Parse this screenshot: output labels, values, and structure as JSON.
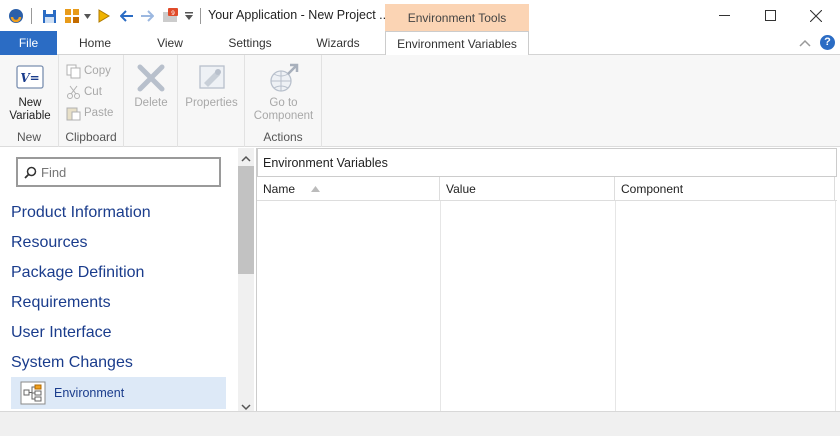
{
  "window": {
    "title": "Your Application - New Project ...",
    "context_tab_header": "Environment Tools"
  },
  "tabs": [
    {
      "label": "File"
    },
    {
      "label": "Home"
    },
    {
      "label": "View"
    },
    {
      "label": "Settings"
    },
    {
      "label": "Wizards"
    },
    {
      "label": "Environment Variables"
    }
  ],
  "ribbon": {
    "new_group": {
      "label": "New",
      "new_variable": "New\nVariable"
    },
    "clipboard_group": {
      "label": "Clipboard",
      "copy": "Copy",
      "cut": "Cut",
      "paste": "Paste"
    },
    "delete": "Delete",
    "properties": "Properties",
    "actions_group": {
      "label": "Actions",
      "go_to_component": "Go to\nComponent"
    }
  },
  "nav": {
    "find_placeholder": "Find",
    "items": [
      "Product Information",
      "Resources",
      "Package Definition",
      "Requirements",
      "User Interface",
      "System Changes"
    ],
    "selected": "Environment"
  },
  "content": {
    "panel_title": "Environment Variables",
    "columns": [
      "Name",
      "Value",
      "Component"
    ]
  },
  "colors": {
    "accent": "#2b6cc4",
    "context_tab": "#fbd4b4",
    "nav_text": "#1a3c8c",
    "selected_bg": "#dde9f7"
  }
}
